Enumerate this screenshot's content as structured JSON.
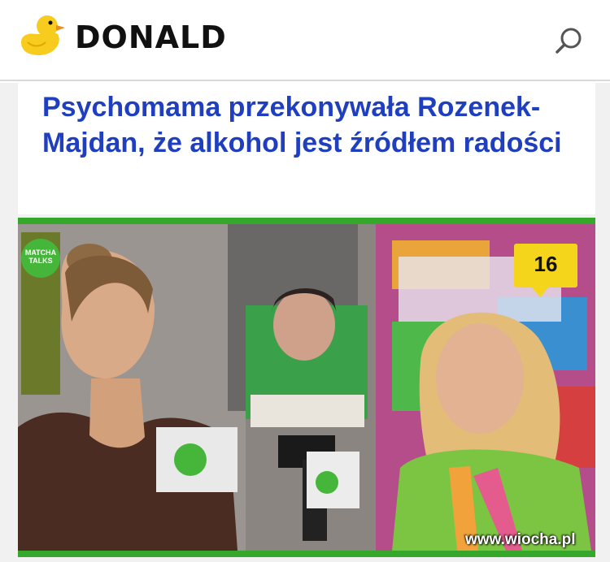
{
  "header": {
    "logo_text": "DONALD",
    "logo_icon": "duck-logo-icon",
    "search_icon": "search-icon"
  },
  "article": {
    "title": "Psychomama przekonywała Rozenek-Majdan, że alkohol jest źródłem radości",
    "comment_count": "16",
    "image_badge": "MATCHA TALKS",
    "colors": {
      "title": "#1f3fbf",
      "frame": "#35a82b",
      "comment_badge": "#f5d51b"
    }
  },
  "watermark": "www.wiocha.pl"
}
